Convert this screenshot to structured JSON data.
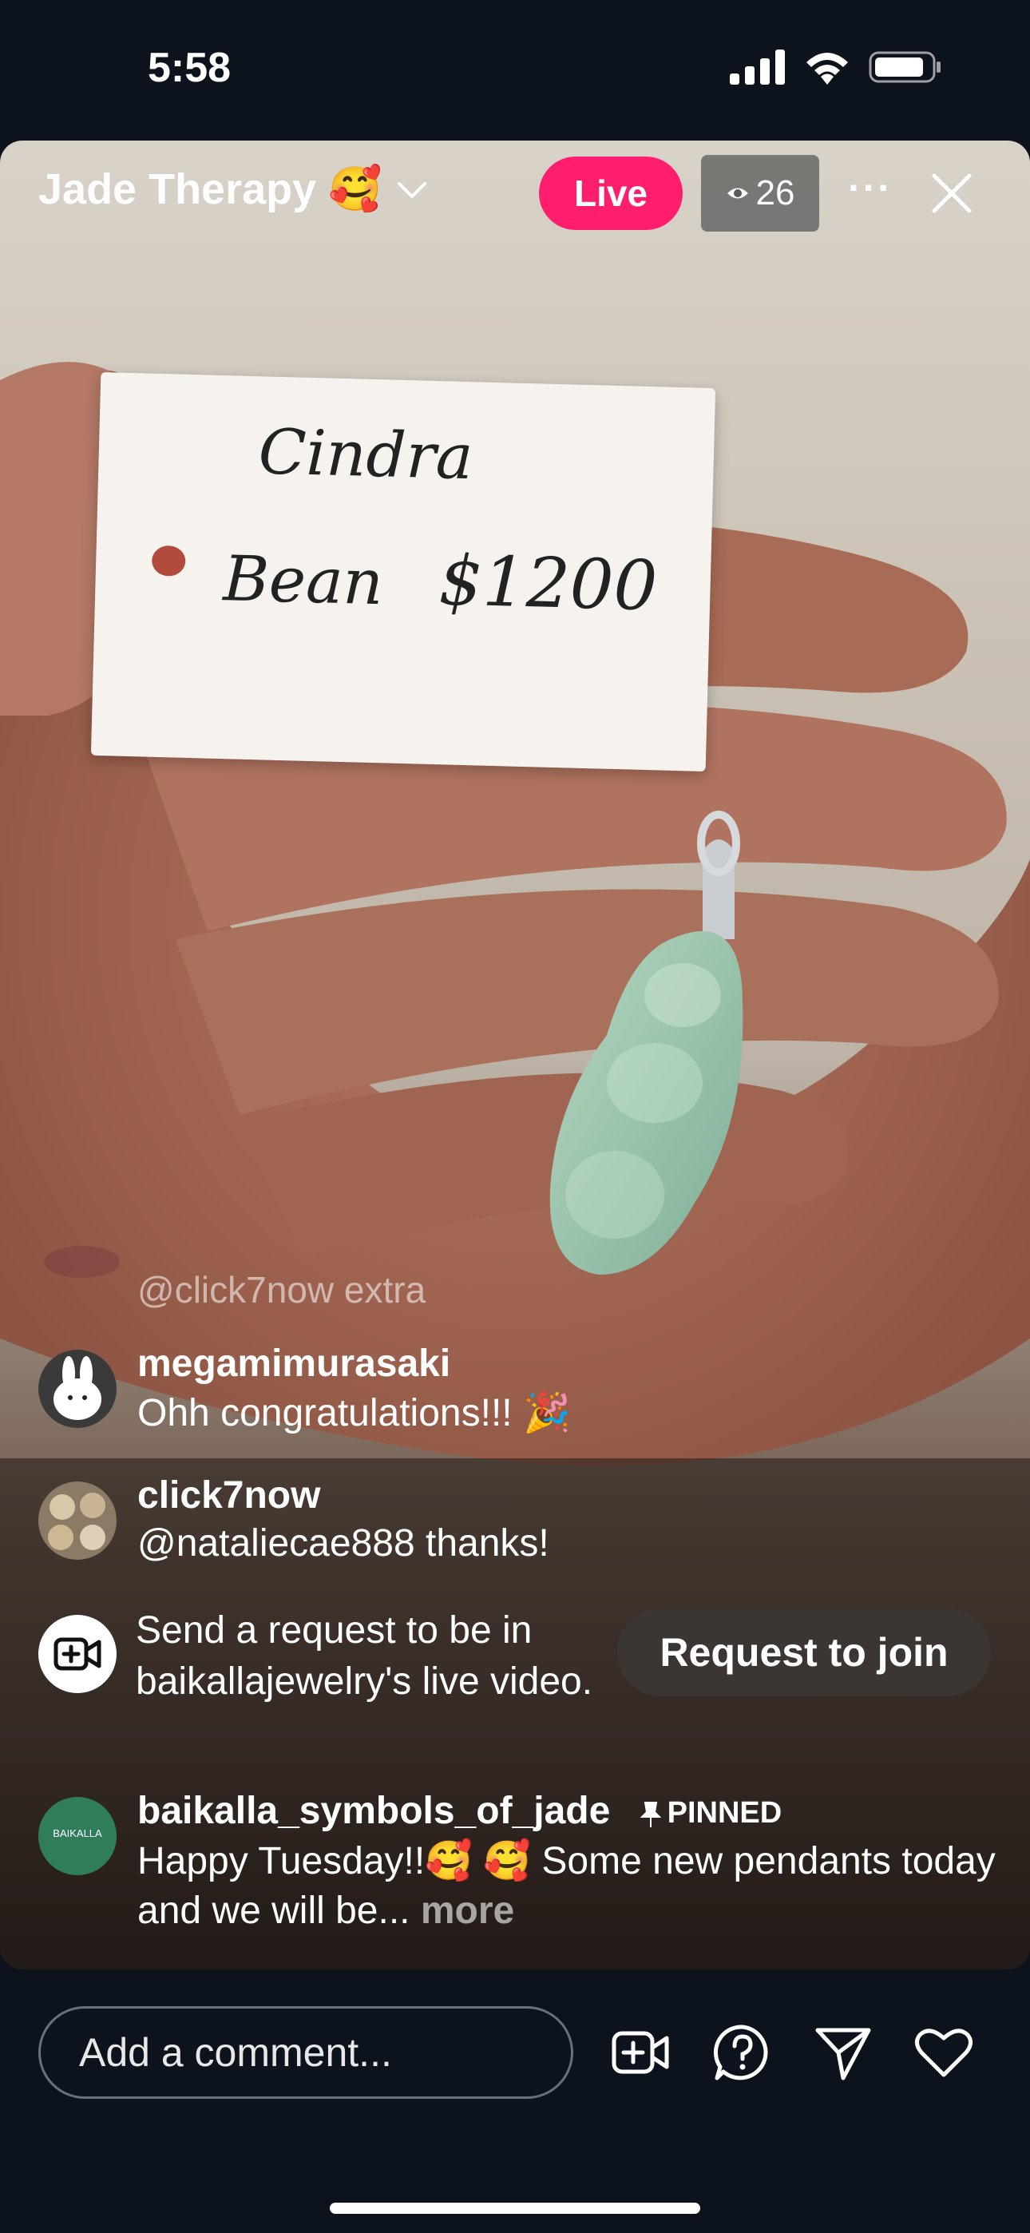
{
  "status_bar": {
    "time": "5:58"
  },
  "header": {
    "title": "Jade Therapy 🥰",
    "live_label": "Live",
    "viewer_count": "26"
  },
  "video": {
    "tag_line1": "Cindra",
    "tag_line2": "Bean",
    "tag_price": "$1200"
  },
  "chat": {
    "ghost_text": "@click7now extra",
    "comments": [
      {
        "user": "megamimurasaki",
        "text": "Ohh congratulations!!! 🎉"
      },
      {
        "user": "click7now",
        "text": "@nataliecae888 thanks!"
      }
    ],
    "request": {
      "text": "Send a request to be in baikallajewelry's live video.",
      "button": "Request to join"
    },
    "pinned": {
      "user": "baikalla_symbols_of_jade",
      "pinned_label": "PINNED",
      "text": "Happy Tuesday!!🥰 🥰 Some new pendants today and we will be...",
      "more": "more",
      "avatar_text": "BAIKALLA"
    }
  },
  "bottom_bar": {
    "comment_placeholder": "Add a comment..."
  },
  "icons": [
    "chevron-down-icon",
    "eye-icon",
    "more-icon",
    "close-icon",
    "video-add-icon",
    "question-icon",
    "send-icon",
    "heart-icon",
    "pin-icon",
    "signal-icon",
    "wifi-icon",
    "battery-icon"
  ],
  "colors": {
    "live": "#ff1e6e",
    "background": "#0d131c"
  }
}
